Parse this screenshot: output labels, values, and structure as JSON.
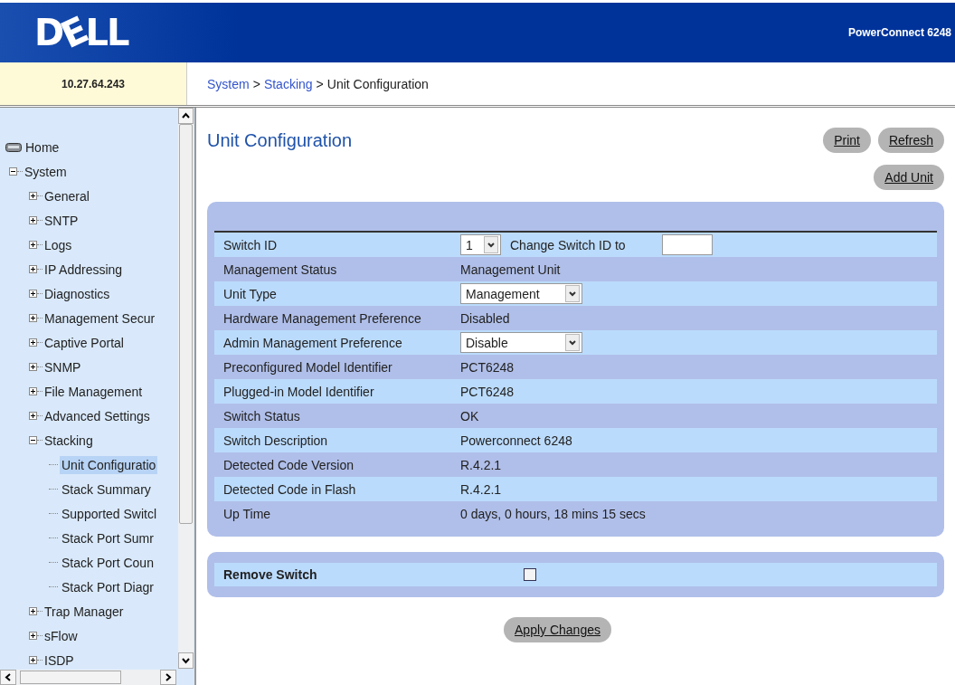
{
  "header": {
    "logo": "DELL",
    "product": "PowerConnect 6248"
  },
  "address": "10.27.64.243",
  "breadcrumb": [
    {
      "label": "System",
      "link": true
    },
    {
      "label": "Stacking",
      "link": true
    },
    {
      "label": "Unit Configuration",
      "link": false
    }
  ],
  "breadcrumb_separator": ">",
  "sidebar": {
    "items": [
      {
        "label": "Home",
        "kind": "home",
        "selected": false
      },
      {
        "label": "System",
        "kind": "folder",
        "expanded": true,
        "selected": false,
        "children": [
          {
            "label": "General",
            "kind": "folder",
            "expanded": false,
            "selected": false
          },
          {
            "label": "SNTP",
            "kind": "folder",
            "expanded": false,
            "selected": false
          },
          {
            "label": "Logs",
            "kind": "folder",
            "expanded": false,
            "selected": false
          },
          {
            "label": "IP Addressing",
            "kind": "folder",
            "expanded": false,
            "selected": false
          },
          {
            "label": "Diagnostics",
            "kind": "folder",
            "expanded": false,
            "selected": false
          },
          {
            "label": "Management Secur",
            "kind": "folder",
            "expanded": false,
            "selected": false
          },
          {
            "label": "Captive Portal",
            "kind": "folder",
            "expanded": false,
            "selected": false
          },
          {
            "label": "SNMP",
            "kind": "folder",
            "expanded": false,
            "selected": false
          },
          {
            "label": "File Management",
            "kind": "folder",
            "expanded": false,
            "selected": false
          },
          {
            "label": "Advanced Settings",
            "kind": "folder",
            "expanded": false,
            "selected": false
          },
          {
            "label": "Stacking",
            "kind": "folder",
            "expanded": true,
            "selected": false,
            "children": [
              {
                "label": "Unit Configuratio",
                "kind": "leaf",
                "selected": true
              },
              {
                "label": "Stack Summary",
                "kind": "leaf",
                "selected": false
              },
              {
                "label": "Supported Switcl",
                "kind": "leaf",
                "selected": false
              },
              {
                "label": "Stack Port Sumr",
                "kind": "leaf",
                "selected": false
              },
              {
                "label": "Stack Port Coun",
                "kind": "leaf",
                "selected": false
              },
              {
                "label": "Stack Port Diagr",
                "kind": "leaf",
                "selected": false
              }
            ]
          },
          {
            "label": "Trap Manager",
            "kind": "folder",
            "expanded": false,
            "selected": false
          },
          {
            "label": "sFlow",
            "kind": "folder",
            "expanded": false,
            "selected": false
          },
          {
            "label": "ISDP",
            "kind": "folder",
            "expanded": false,
            "selected": false
          }
        ]
      }
    ]
  },
  "page": {
    "title": "Unit Configuration",
    "buttons": [
      "Print",
      "Refresh"
    ],
    "add_button": "Add Unit"
  },
  "rows": [
    {
      "label": "Switch ID",
      "kind": "switch-id",
      "value": "1",
      "extra_label": "Change Switch ID to"
    },
    {
      "label": "Management Status",
      "kind": "text",
      "value": "Management Unit"
    },
    {
      "label": "Unit Type",
      "kind": "select",
      "value": "Management"
    },
    {
      "label": "Hardware Management Preference",
      "kind": "text",
      "value": "Disabled"
    },
    {
      "label": "Admin Management Preference",
      "kind": "select",
      "value": "Disable"
    },
    {
      "label": "Preconfigured Model Identifier",
      "kind": "text",
      "value": "PCT6248"
    },
    {
      "label": "Plugged-in Model Identifier",
      "kind": "text",
      "value": "PCT6248"
    },
    {
      "label": "Switch Status",
      "kind": "text",
      "value": "OK"
    },
    {
      "label": "Switch Description",
      "kind": "text",
      "value": "Powerconnect 6248"
    },
    {
      "label": "Detected Code Version",
      "kind": "text",
      "value": "R.4.2.1"
    },
    {
      "label": "Detected Code in Flash",
      "kind": "text",
      "value": "R.4.2.1"
    },
    {
      "label": "Up Time",
      "kind": "text",
      "value": "0 days, 0 hours, 18 mins 15 secs"
    }
  ],
  "remove_switch": {
    "label": "Remove Switch",
    "checked": false
  },
  "apply_button": "Apply Changes"
}
